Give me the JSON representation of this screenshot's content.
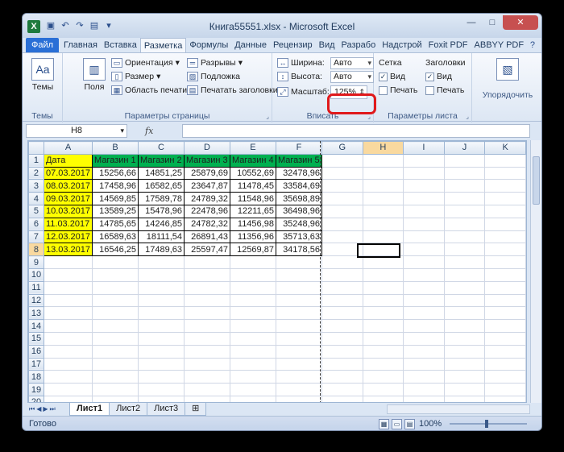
{
  "window": {
    "title": "Книга55551.xlsx - Microsoft Excel"
  },
  "ribbon_tabs": [
    "Файл",
    "Главная",
    "Вставка",
    "Разметка",
    "Формулы",
    "Данные",
    "Рецензир",
    "Вид",
    "Разрабо",
    "Надстрой",
    "Foxit PDF",
    "ABBYY PDF"
  ],
  "active_tab": "Разметка",
  "groups": {
    "themes": {
      "label": "Темы",
      "button": "Темы"
    },
    "page_setup": {
      "label": "Параметры страницы",
      "fields": "Поля",
      "orientation": "Ориентация",
      "size": "Размер",
      "print_area": "Область печати",
      "breaks": "Разрывы",
      "background": "Подложка",
      "print_titles": "Печатать заголовки"
    },
    "fit": {
      "label": "Вписать",
      "width_label": "Ширина:",
      "width_value": "Авто",
      "height_label": "Высота:",
      "height_value": "Авто",
      "scale_label": "Масштаб:",
      "scale_value": "125%"
    },
    "sheet_options": {
      "label": "Параметры листа",
      "gridlines": "Сетка",
      "headings": "Заголовки",
      "view": "Вид",
      "print": "Печать",
      "view2": "Вид",
      "print2": "Печать"
    },
    "arrange": {
      "label": "Упорядочить"
    }
  },
  "formula_bar": {
    "name_box": "H8",
    "fx": "fx",
    "formula": ""
  },
  "columns": [
    "A",
    "B",
    "C",
    "D",
    "E",
    "F",
    "G",
    "H",
    "I",
    "J",
    "K"
  ],
  "headers": [
    "Дата",
    "Магазин 1",
    "Магазин 2",
    "Магазин 3",
    "Магазин 4",
    "Магазин 5"
  ],
  "rows": [
    [
      "07.03.2017",
      "15256,66",
      "14851,25",
      "25879,69",
      "10552,69",
      "32478,96"
    ],
    [
      "08.03.2017",
      "17458,96",
      "16582,65",
      "23647,87",
      "11478,45",
      "33584,69"
    ],
    [
      "09.03.2017",
      "14569,85",
      "17589,78",
      "24789,32",
      "11548,96",
      "35698,89"
    ],
    [
      "10.03.2017",
      "13589,25",
      "15478,96",
      "22478,96",
      "12211,65",
      "36498,96"
    ],
    [
      "11.03.2017",
      "14785,65",
      "14246,85",
      "24782,32",
      "11456,98",
      "35248,96"
    ],
    [
      "12.03.2017",
      "16589,63",
      "18111,54",
      "26891,43",
      "11356,96",
      "35713,63"
    ],
    [
      "13.03.2017",
      "16546,25",
      "17489,63",
      "25597,47",
      "12569,87",
      "34178,56"
    ]
  ],
  "row_numbers": [
    "1",
    "2",
    "3",
    "4",
    "5",
    "6",
    "7",
    "8",
    "9",
    "10",
    "11",
    "12",
    "13",
    "14",
    "15",
    "16",
    "17",
    "18",
    "19",
    "20"
  ],
  "sheets": [
    "Лист1",
    "Лист2",
    "Лист3"
  ],
  "status": {
    "ready": "Готово",
    "zoom": "100%"
  },
  "colors": {
    "date_fill": "#ffff00",
    "header_fill": "#00b050",
    "scale_highlight": "#e0191b"
  }
}
